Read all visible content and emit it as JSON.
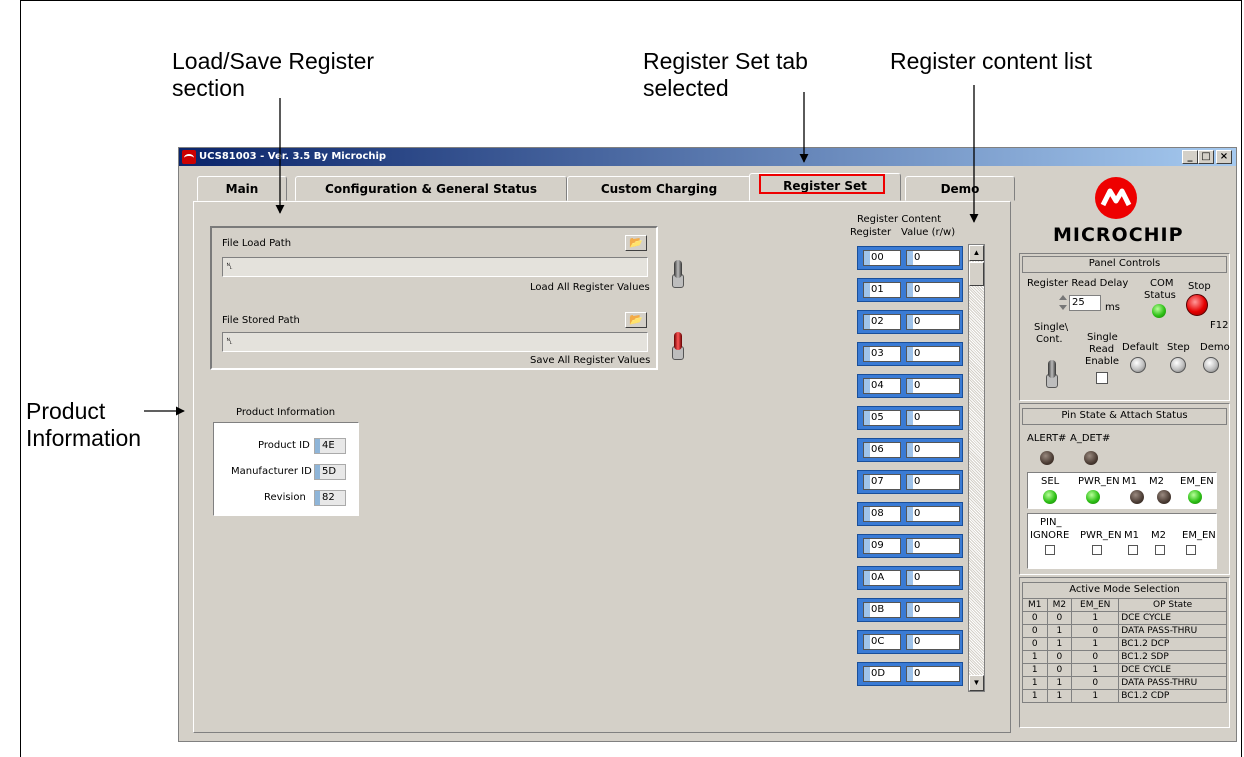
{
  "callouts": {
    "load_save_1": "Load/Save Register",
    "load_save_2": "section",
    "register_set_1": "Register Set tab",
    "register_set_2": "selected",
    "content_list": "Register content list",
    "product_1": "Product",
    "product_2": "Information"
  },
  "window": {
    "title": "UCS81003 - Ver. 3.5 By Microchip",
    "min": "_",
    "max": "□",
    "close": "×"
  },
  "tabs": [
    "Main",
    "Configuration & General Status",
    "Custom Charging",
    "Register Set",
    "Demo"
  ],
  "load_save": {
    "load_label": "File Load Path",
    "load_value": "␤",
    "load_action": "Load All Register Values",
    "store_label": "File Stored Path",
    "store_value": "␤",
    "store_action": "Save All Register Values",
    "folder_icon": "folder-open-icon"
  },
  "product_info": {
    "title": "Product Information",
    "rows": [
      {
        "label": "Product ID",
        "value": "4E"
      },
      {
        "label": "Manufacturer ID",
        "value": "5D"
      },
      {
        "label": "Revision",
        "value": "82"
      }
    ]
  },
  "register_list": {
    "heading": "Register Content",
    "col_register": "Register",
    "col_value": "Value (r/w)",
    "rows": [
      {
        "reg": "00",
        "val": "0"
      },
      {
        "reg": "01",
        "val": "0"
      },
      {
        "reg": "02",
        "val": "0"
      },
      {
        "reg": "03",
        "val": "0"
      },
      {
        "reg": "04",
        "val": "0"
      },
      {
        "reg": "05",
        "val": "0"
      },
      {
        "reg": "06",
        "val": "0"
      },
      {
        "reg": "07",
        "val": "0"
      },
      {
        "reg": "08",
        "val": "0"
      },
      {
        "reg": "09",
        "val": "0"
      },
      {
        "reg": "0A",
        "val": "0"
      },
      {
        "reg": "0B",
        "val": "0"
      },
      {
        "reg": "0C",
        "val": "0"
      },
      {
        "reg": "0D",
        "val": "0"
      }
    ]
  },
  "brand": {
    "name": "MICROCHIP",
    "color": "#e00000"
  },
  "panel_controls": {
    "title": "Panel Controls",
    "read_delay_label": "Register Read Delay",
    "read_delay_value": "25",
    "read_delay_unit": "ms",
    "com_status_1": "COM",
    "com_status_2": "Status",
    "stop_label": "Stop",
    "stop_key": "F12",
    "single_cont_1": "Single\\",
    "single_cont_2": "Cont.",
    "single_read_1": "Single",
    "single_read_2": "Read",
    "single_read_3": "Enable",
    "default_label": "Default",
    "step_label": "Step",
    "demo_label": "Demo"
  },
  "pin_state": {
    "title": "Pin State & Attach Status",
    "alert": "ALERT#",
    "adet": "A_DET#",
    "leds": [
      {
        "label": "SEL",
        "state": "on"
      },
      {
        "label": "PWR_EN",
        "state": "on"
      },
      {
        "label": "M1",
        "state": "off"
      },
      {
        "label": "M2",
        "state": "off"
      },
      {
        "label": "EM_EN",
        "state": "on"
      }
    ],
    "ignore_1": "PIN_",
    "ignore_2": "IGNORE",
    "ignore_cols": [
      "PWR_EN",
      "M1",
      "M2",
      "EM_EN"
    ]
  },
  "active_mode": {
    "title": "Active Mode Selection",
    "headers": [
      "M1",
      "M2",
      "EM_EN",
      "OP State"
    ],
    "rows": [
      [
        "0",
        "0",
        "1",
        "DCE CYCLE"
      ],
      [
        "0",
        "1",
        "0",
        "DATA PASS-THRU"
      ],
      [
        "0",
        "1",
        "1",
        "BC1.2 DCP"
      ],
      [
        "1",
        "0",
        "0",
        "BC1.2 SDP"
      ],
      [
        "1",
        "0",
        "1",
        "DCE CYCLE"
      ],
      [
        "1",
        "1",
        "0",
        "DATA PASS-THRU"
      ],
      [
        "1",
        "1",
        "1",
        "BC1.2 CDP"
      ]
    ]
  }
}
